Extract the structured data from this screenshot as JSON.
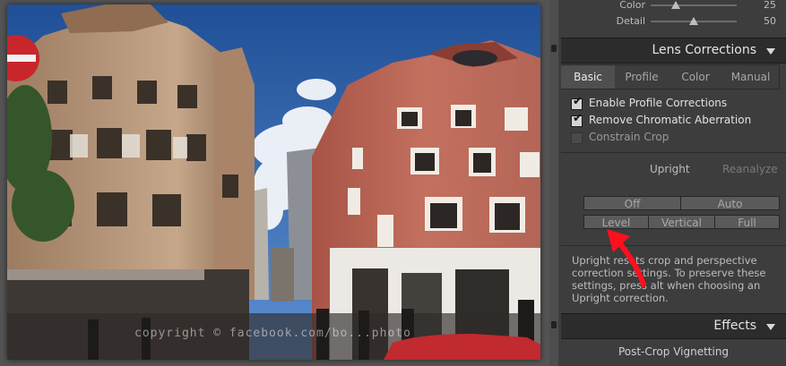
{
  "panel": {
    "sliders": [
      {
        "label": "Color",
        "value": "25",
        "position": 0.25
      },
      {
        "label": "Detail",
        "value": "50",
        "position": 0.5
      }
    ],
    "lens_corrections": {
      "title": "Lens Corrections",
      "tabs": [
        "Basic",
        "Profile",
        "Color",
        "Manual"
      ],
      "active_tab": "Basic",
      "checkboxes": [
        {
          "label": "Enable Profile Corrections",
          "checked": true
        },
        {
          "label": "Remove Chromatic Aberration",
          "checked": true
        },
        {
          "label": "Constrain Crop",
          "checked": false
        }
      ],
      "upright_label": "Upright",
      "reanalyze_label": "Reanalyze",
      "upright_buttons": [
        "Off",
        "Auto",
        "Level",
        "Vertical",
        "Full"
      ],
      "help_text": "Upright resets crop and perspective correction settings. To preserve these settings, press alt when choosing an Upright correction."
    },
    "effects": {
      "title": "Effects",
      "subsection": "Post-Crop Vignetting"
    }
  },
  "photo": {
    "watermark": "copyright © facebook.com/bo...photo"
  },
  "colors": {
    "annotation_arrow": "#ff0f1e"
  }
}
